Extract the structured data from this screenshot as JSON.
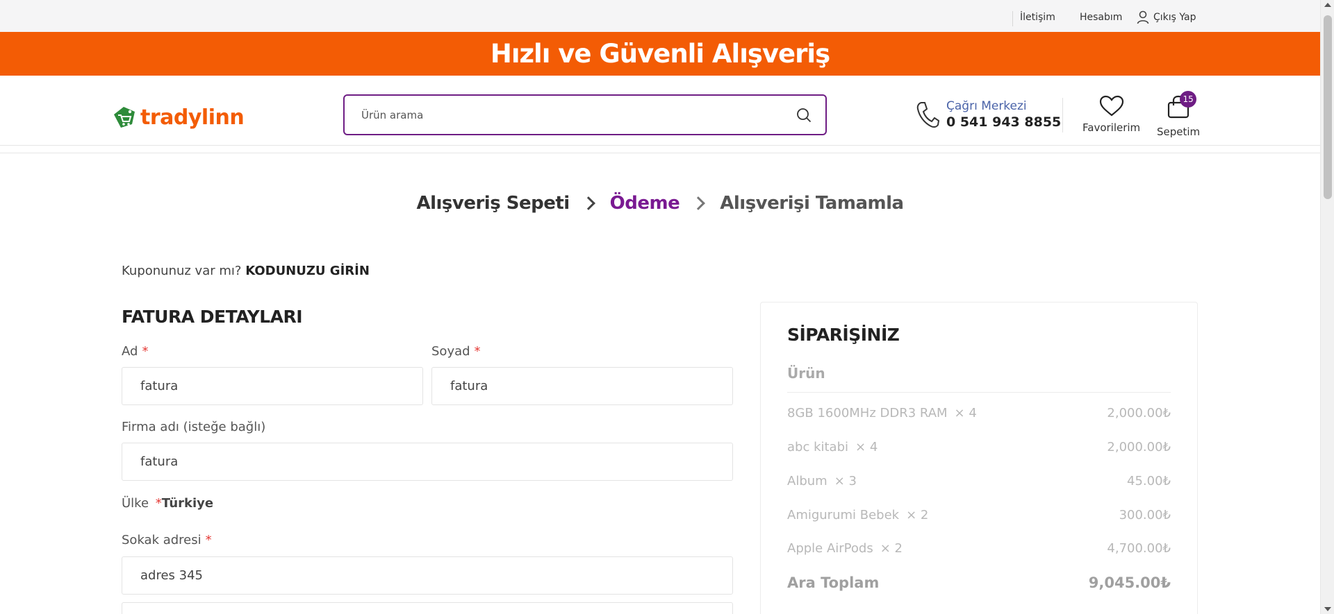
{
  "topbar": {
    "links": [
      "İletişim",
      "Hesabım"
    ],
    "logout_label": "Çıkış Yap"
  },
  "banner": {
    "text": "Hızlı ve Güvenli Alışveriş",
    "color": "#f35c05"
  },
  "header": {
    "logo_text": "tradylinn",
    "search_placeholder": "Ürün arama",
    "call_center_label": "Çağrı Merkezi",
    "call_center_number": "0 541 943 8855",
    "favorites_label": "Favorilerim",
    "cart_label": "Sepetim",
    "cart_count": "15",
    "accent_color": "#6e1d84"
  },
  "steps": [
    "Alışveriş Sepeti",
    "Ödeme",
    "Alışverişi Tamamla"
  ],
  "coupon": {
    "question": "Kuponunuz var mı?",
    "action": "KODUNUZU GİRİN"
  },
  "billing": {
    "title": "FATURA DETAYLARI",
    "first_name_label": "Ad",
    "first_name_value": "fatura",
    "last_name_label": "Soyad",
    "last_name_value": "fatura",
    "company_label": "Firma adı (isteğe bağlı)",
    "company_value": "fatura",
    "country_label": "Ülke",
    "country_value": "Türkiye",
    "street_label": "Sokak adresi",
    "street_value": "adres 345",
    "required_mark": "*"
  },
  "order": {
    "title": "SİPARİŞİNİZ",
    "column_product": "Ürün",
    "items": [
      {
        "name": "8GB 1600MHz DDR3 RAM",
        "qty": "× 4",
        "price": "2,000.00₺"
      },
      {
        "name": "abc kitabi",
        "qty": "× 4",
        "price": "2,000.00₺"
      },
      {
        "name": "Album",
        "qty": "× 3",
        "price": "45.00₺"
      },
      {
        "name": "Amigurumi Bebek",
        "qty": "× 2",
        "price": "300.00₺"
      },
      {
        "name": "Apple AirPods",
        "qty": "× 2",
        "price": "4,700.00₺"
      }
    ],
    "subtotal_label": "Ara Toplam",
    "subtotal_value": "9,045.00₺"
  }
}
